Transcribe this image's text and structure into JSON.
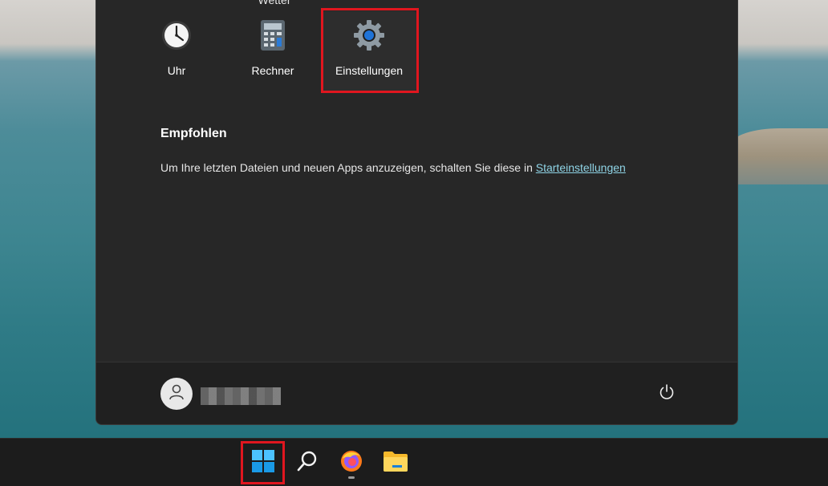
{
  "pinned": {
    "partial_label": "Wetter",
    "apps": [
      {
        "label": "Uhr",
        "icon": "clock-icon"
      },
      {
        "label": "Rechner",
        "icon": "calculator-icon"
      },
      {
        "label": "Einstellungen",
        "icon": "gear-icon",
        "selected": true
      }
    ]
  },
  "recommended": {
    "title": "Empfohlen",
    "text": "Um Ihre letzten Dateien und neuen Apps anzuzeigen, schalten Sie diese in ",
    "link": "Starteinstellungen"
  },
  "footer": {
    "user_icon": "user-icon",
    "username_redacted": true,
    "power_icon": "power-icon"
  },
  "taskbar": {
    "items": [
      {
        "icon": "windows-start-icon",
        "highlighted": true
      },
      {
        "icon": "search-icon"
      },
      {
        "icon": "firefox-icon",
        "running": true
      },
      {
        "icon": "file-explorer-icon"
      }
    ]
  },
  "colors": {
    "highlight": "#e0161f",
    "menu_bg": "#272727",
    "link": "#8fd4e6",
    "taskbar_bg": "#1c1c1c"
  }
}
